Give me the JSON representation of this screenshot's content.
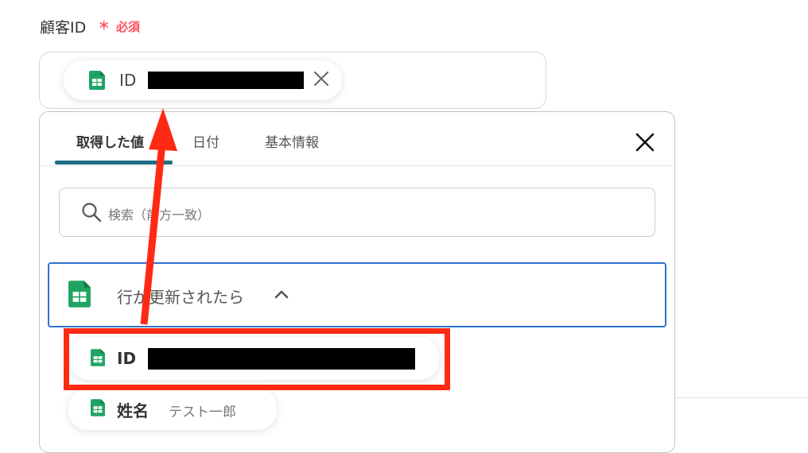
{
  "field": {
    "label": "顧客ID",
    "required_star": "∗",
    "required_text": "必須"
  },
  "selected_chip": {
    "label": "ID",
    "icon": "google-sheets-icon",
    "remove_icon": "close-icon"
  },
  "panel": {
    "tabs": [
      {
        "label": "取得した値",
        "active": true
      },
      {
        "label": "日付",
        "active": false
      },
      {
        "label": "基本情報",
        "active": false
      }
    ],
    "close_icon": "close-icon"
  },
  "search": {
    "placeholder": "検索（前方一致）",
    "icon": "search-icon"
  },
  "group": {
    "label": "行が更新されたら",
    "icon": "google-sheets-icon",
    "chevron": "chevron-up-icon"
  },
  "items": [
    {
      "label": "ID",
      "value": ""
    },
    {
      "label": "姓名",
      "value": "テスト一郎"
    }
  ],
  "colors": {
    "required": "#ff4d5a",
    "accent_tab": "#1f6f86",
    "group_border": "#2b73d1",
    "annotation_red": "#ff2a14",
    "sheets_green": "#1fa463"
  }
}
